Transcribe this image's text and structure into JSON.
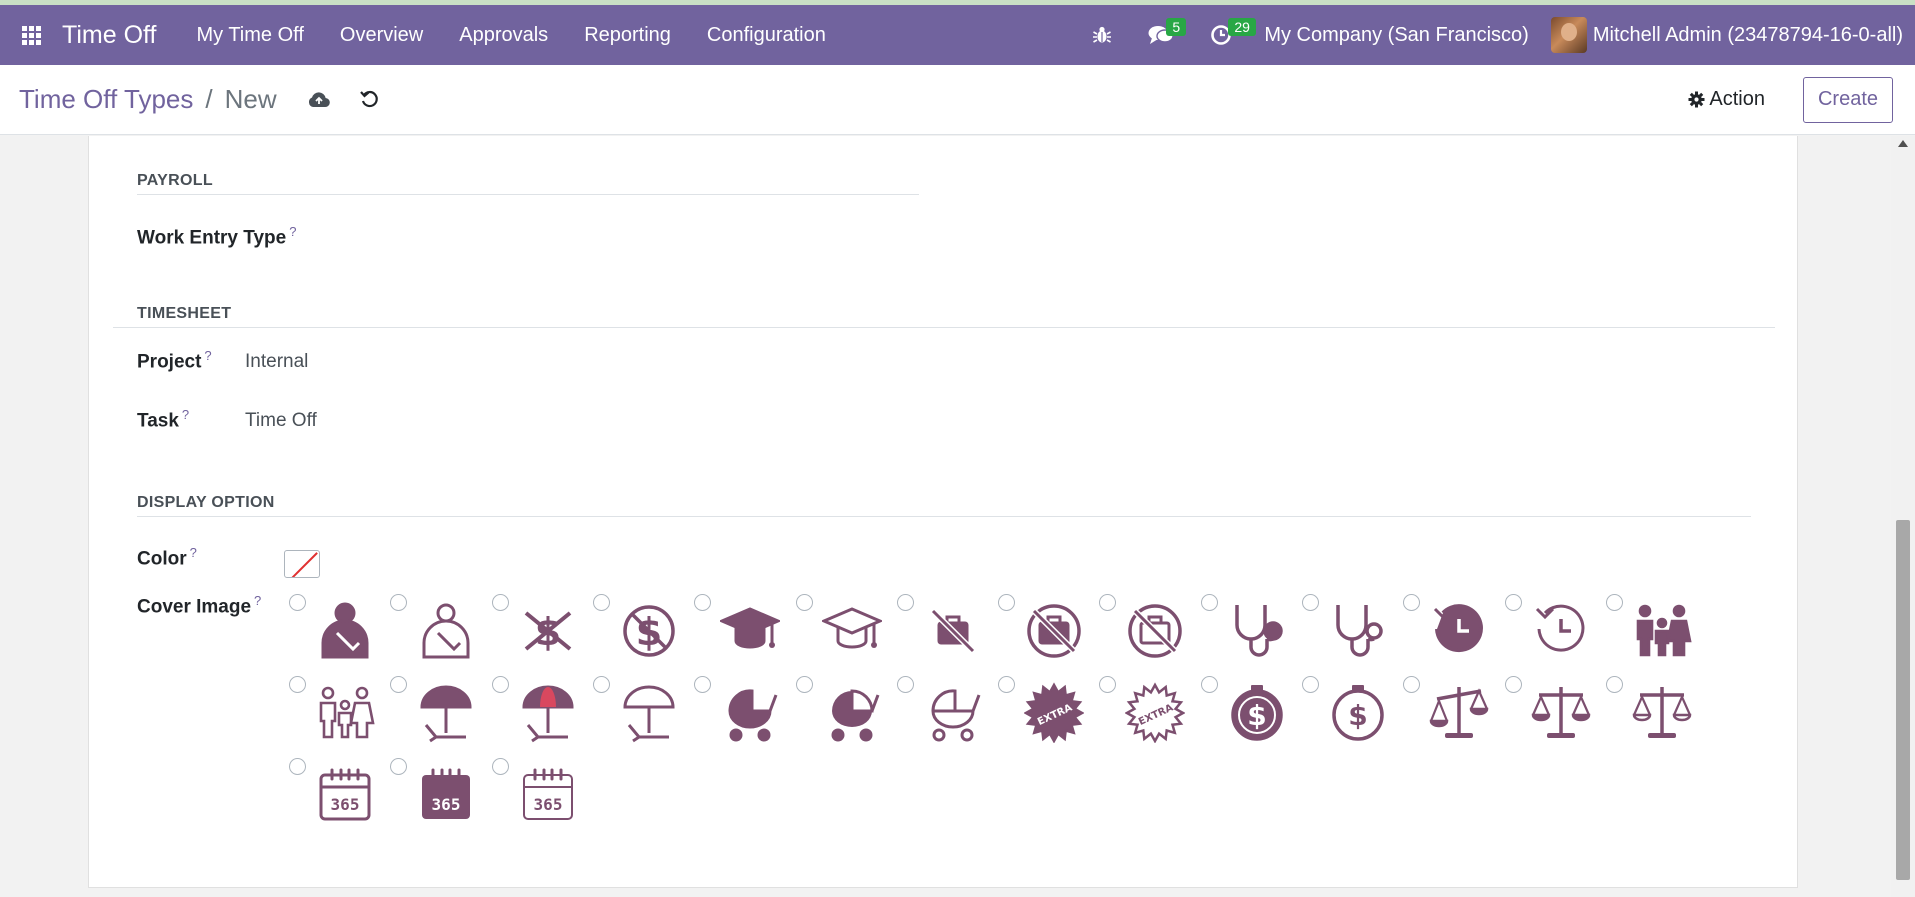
{
  "navbar": {
    "brand": "Time Off",
    "menu": [
      "My Time Off",
      "Overview",
      "Approvals",
      "Reporting",
      "Configuration"
    ],
    "messages_count": "5",
    "activities_count": "29",
    "company": "My Company (San Francisco)",
    "user": "Mitchell Admin (23478794-16-0-all)"
  },
  "control_panel": {
    "breadcrumb_parent": "Time Off Types",
    "breadcrumb_separator": "/",
    "breadcrumb_current": "New",
    "action_label": "Action",
    "create_label": "Create"
  },
  "form": {
    "payroll": {
      "title": "PAYROLL",
      "work_entry_type_label": "Work Entry Type",
      "work_entry_type_value": ""
    },
    "timesheet": {
      "title": "TIMESHEET",
      "project_label": "Project",
      "project_value": "Internal",
      "task_label": "Task",
      "task_value": "Time Off"
    },
    "display": {
      "title": "DISPLAY OPTION",
      "color_label": "Color",
      "cover_image_label": "Cover Image"
    },
    "help_mark": "?"
  },
  "cover_images": [
    {
      "icon": "injured-person-solid-icon"
    },
    {
      "icon": "injured-person-outline-icon"
    },
    {
      "icon": "no-dollar-x-icon"
    },
    {
      "icon": "no-dollar-circle-icon"
    },
    {
      "icon": "graduation-cap-solid-icon"
    },
    {
      "icon": "graduation-cap-outline-icon"
    },
    {
      "icon": "no-briefcase-icon"
    },
    {
      "icon": "no-briefcase-circle-solid-icon"
    },
    {
      "icon": "no-briefcase-circle-outline-icon"
    },
    {
      "icon": "stethoscope-solid-icon"
    },
    {
      "icon": "stethoscope-outline-icon"
    },
    {
      "icon": "history-solid-icon"
    },
    {
      "icon": "history-outline-icon"
    },
    {
      "icon": "family-solid-icon"
    },
    {
      "icon": "family-outline-icon"
    },
    {
      "icon": "beach-umbrella-solid-icon"
    },
    {
      "icon": "beach-umbrella-color-icon"
    },
    {
      "icon": "beach-umbrella-outline-icon"
    },
    {
      "icon": "baby-stroller-solid-icon"
    },
    {
      "icon": "baby-carriage-solid-icon"
    },
    {
      "icon": "baby-stroller-outline-icon"
    },
    {
      "icon": "extra-badge-solid-icon"
    },
    {
      "icon": "extra-badge-outline-icon"
    },
    {
      "icon": "dollar-coin-solid-icon"
    },
    {
      "icon": "dollar-coin-outline-icon"
    },
    {
      "icon": "scale-balance-tilted-icon"
    },
    {
      "icon": "scale-balance-solid-icon"
    },
    {
      "icon": "scale-balance-outline-icon"
    },
    {
      "icon": "calendar-365-outline-icon",
      "text": "365"
    },
    {
      "icon": "calendar-365-solid-icon",
      "text": "365"
    },
    {
      "icon": "calendar-365-light-icon",
      "text": "365"
    }
  ],
  "colors": {
    "primary": "#71639e",
    "icon": "#7c4f6f",
    "badge": "#28a745"
  }
}
